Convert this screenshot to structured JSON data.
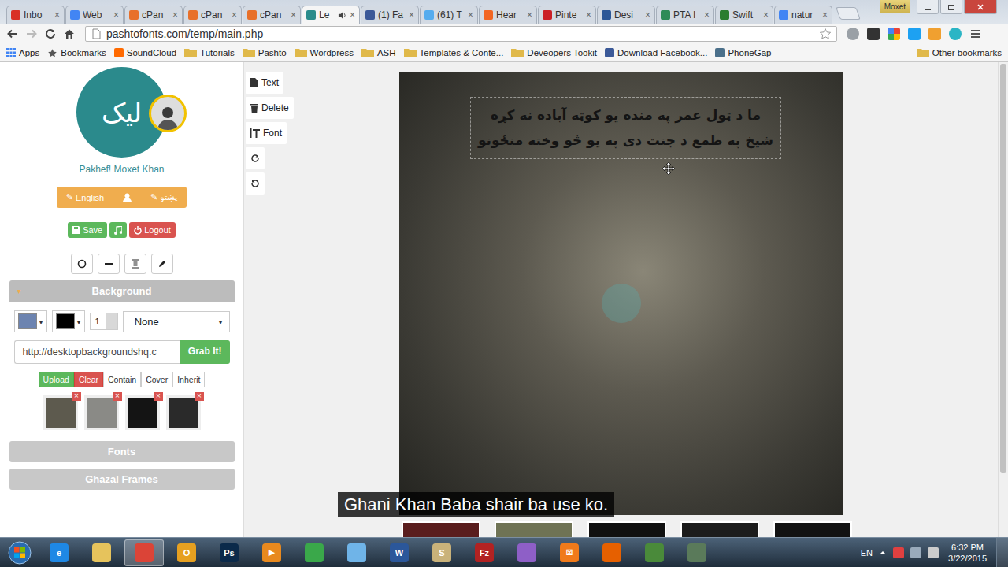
{
  "browser": {
    "tabs": [
      {
        "label": "Inbo",
        "selected": false,
        "audio": false,
        "color": "#d93025"
      },
      {
        "label": "Web",
        "selected": false,
        "audio": false,
        "color": "#4285f4"
      },
      {
        "label": "cPan",
        "selected": false,
        "audio": false,
        "color": "#e8702a"
      },
      {
        "label": "cPan",
        "selected": false,
        "audio": false,
        "color": "#e8702a"
      },
      {
        "label": "cPan",
        "selected": false,
        "audio": false,
        "color": "#e8702a"
      },
      {
        "label": "Le",
        "selected": true,
        "audio": true,
        "color": "#2a8c8c"
      },
      {
        "label": "(1) Fa",
        "selected": false,
        "audio": false,
        "color": "#3b5998"
      },
      {
        "label": "(61) T",
        "selected": false,
        "audio": false,
        "color": "#55acee"
      },
      {
        "label": "Hear",
        "selected": false,
        "audio": false,
        "color": "#f26522"
      },
      {
        "label": "Pinte",
        "selected": false,
        "audio": false,
        "color": "#cb2027"
      },
      {
        "label": "Desi",
        "selected": false,
        "audio": false,
        "color": "#2b5797"
      },
      {
        "label": "PTA I",
        "selected": false,
        "audio": false,
        "color": "#2e8b57"
      },
      {
        "label": "Swift",
        "selected": false,
        "audio": false,
        "color": "#2a7d2e"
      },
      {
        "label": "natur",
        "selected": false,
        "audio": false,
        "color": "#4285f4"
      }
    ],
    "close": "×",
    "profile": "Moxet",
    "url": "pashtofonts.com/temp/main.php",
    "bookmarks": [
      {
        "label": "Apps",
        "kind": "apps",
        "color": "#4285f4"
      },
      {
        "label": "Bookmarks",
        "kind": "star",
        "color": "#555555"
      },
      {
        "label": "SoundCloud",
        "kind": "site",
        "color": "#ff6a00"
      },
      {
        "label": "Tutorials",
        "kind": "folder",
        "color": "#e0b94a"
      },
      {
        "label": "Pashto",
        "kind": "folder",
        "color": "#e0b94a"
      },
      {
        "label": "Wordpress",
        "kind": "folder",
        "color": "#e0b94a"
      },
      {
        "label": "ASH",
        "kind": "folder",
        "color": "#e0b94a"
      },
      {
        "label": "Templates & Conte...",
        "kind": "folder",
        "color": "#e0b94a"
      },
      {
        "label": "Deveopers Tookit",
        "kind": "folder",
        "color": "#e0b94a"
      },
      {
        "label": "Download Facebook...",
        "kind": "site",
        "color": "#3b5998"
      },
      {
        "label": "PhoneGap",
        "kind": "site",
        "color": "#4a6f8a"
      }
    ],
    "other_bookmarks": "Other bookmarks"
  },
  "sidebar": {
    "logo": "لیک",
    "name": "Pakhef! Moxet Khan",
    "lang_buttons": [
      {
        "kind": "text",
        "icon": "✎",
        "label": "English"
      },
      {
        "kind": "user",
        "icon": "",
        "label": ""
      },
      {
        "kind": "text",
        "icon": "✎",
        "label": "پښتو"
      }
    ],
    "actions": [
      {
        "kind": "save",
        "label": "Save",
        "color": "#5cb85c"
      },
      {
        "kind": "music",
        "label": "",
        "color": "#5cb85c"
      },
      {
        "kind": "logout",
        "label": "Logout",
        "color": "#d9534f"
      }
    ],
    "shape_tools": [
      {
        "kind": "circle"
      },
      {
        "kind": "line"
      },
      {
        "kind": "list"
      },
      {
        "kind": "pencil"
      }
    ],
    "caret": "▾",
    "sections": [
      {
        "label": "Background",
        "expanded": true
      },
      {
        "label": "Fonts",
        "expanded": false
      },
      {
        "label": "Ghazal Frames",
        "expanded": false
      }
    ],
    "background": {
      "swatches": [
        {
          "color": "#6d84b0"
        },
        {
          "color": "#000000"
        }
      ],
      "width": "1",
      "repeat": "None",
      "url": "http://desktopbackgroundshq.c",
      "grab": "Grab It!",
      "buttons": [
        {
          "label": "Upload",
          "kind": "green"
        },
        {
          "label": "Clear",
          "kind": "red"
        },
        {
          "label": "Contain",
          "kind": "plain"
        },
        {
          "label": "Cover",
          "kind": "plain"
        },
        {
          "label": "Inherit",
          "kind": "plain"
        }
      ],
      "remove": "×",
      "thumbnails": [
        {
          "color": "#5d5a4e"
        },
        {
          "color": "#8a8a86"
        },
        {
          "color": "#141414"
        },
        {
          "color": "#2a2a2a"
        }
      ]
    }
  },
  "tools": [
    {
      "kind": "text",
      "label": "Text"
    },
    {
      "kind": "delete",
      "label": "Delete"
    },
    {
      "kind": "font",
      "label": "Font"
    },
    {
      "kind": "rotate-cw",
      "label": ""
    },
    {
      "kind": "rotate-ccw",
      "label": ""
    }
  ],
  "canvas": {
    "lines": [
      "ما د ټول عمر په منده یو کوټه آباده نه کړه",
      "شیخ په طمع د جنت دی په یو څو وخته منځونو"
    ],
    "strip": [
      {
        "color": "#5a1d1d"
      },
      {
        "color": "#6f7355"
      },
      {
        "color": "#101010"
      },
      {
        "color": "#1c1c1c"
      },
      {
        "color": "#121212"
      }
    ]
  },
  "subtitle": "Ghani Khan Baba shair ba use ko.",
  "taskbar": {
    "apps": [
      {
        "glyph": "e",
        "color": "#1e88e5",
        "selected": false
      },
      {
        "glyph": "",
        "color": "#e6c35c",
        "selected": false
      },
      {
        "glyph": "",
        "color": "#db4437",
        "selected": true
      },
      {
        "glyph": "O",
        "color": "#e6a020",
        "selected": false
      },
      {
        "glyph": "Ps",
        "color": "#0b2a4a",
        "selected": false
      },
      {
        "glyph": "▶",
        "color": "#e8891e",
        "selected": false
      },
      {
        "glyph": "",
        "color": "#3aa84a",
        "selected": false
      },
      {
        "glyph": "",
        "color": "#6fb4e8",
        "selected": false
      },
      {
        "glyph": "W",
        "color": "#2b579a",
        "selected": false
      },
      {
        "glyph": "S",
        "color": "#c9b27a",
        "selected": false
      },
      {
        "glyph": "Fz",
        "color": "#b22222",
        "selected": false
      },
      {
        "glyph": "",
        "color": "#8e5fc7",
        "selected": false
      },
      {
        "glyph": "⊠",
        "color": "#f07a1a",
        "selected": false
      },
      {
        "glyph": "",
        "color": "#e66000",
        "selected": false
      },
      {
        "glyph": "",
        "color": "#4a8a3a",
        "selected": false
      },
      {
        "glyph": "",
        "color": "#5a7a5a",
        "selected": false
      }
    ],
    "lang": "EN",
    "time": "6:32 PM",
    "date": "3/22/2015"
  }
}
